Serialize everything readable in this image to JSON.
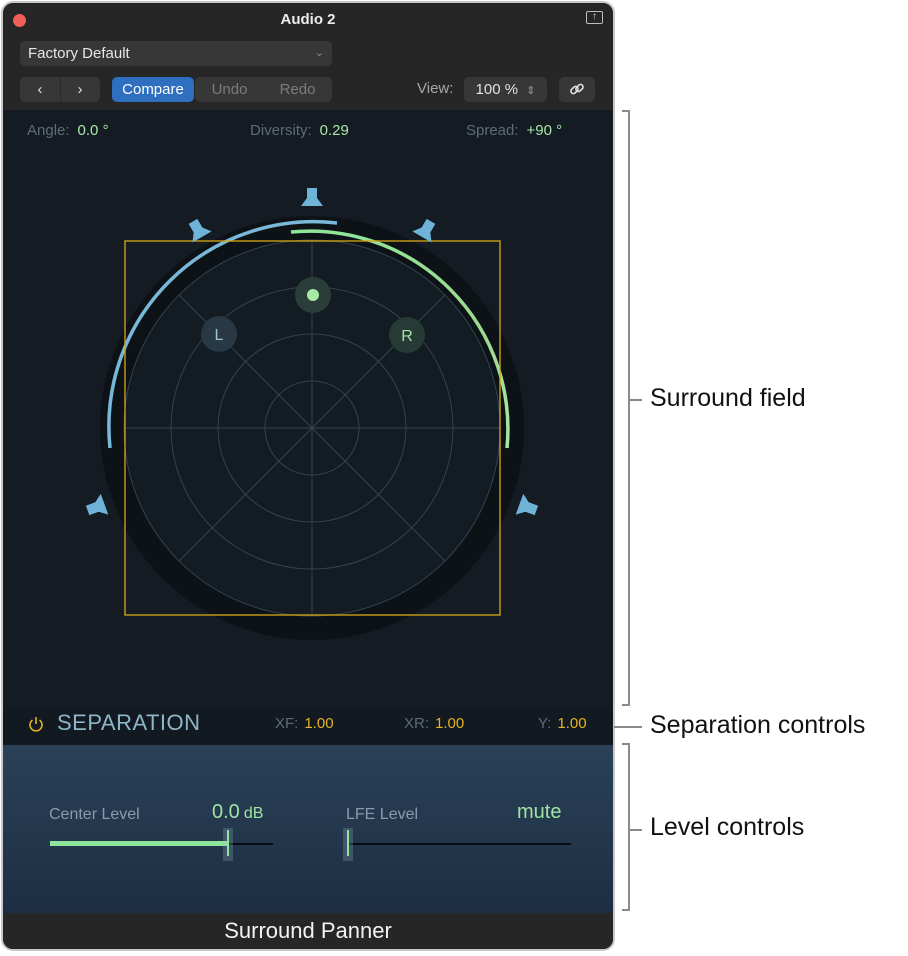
{
  "window": {
    "title": "Audio 2",
    "preset": "Factory Default",
    "footer_title": "Surround Panner"
  },
  "toolbar": {
    "prev_icon": "chevron-left-icon",
    "next_icon": "chevron-right-icon",
    "prev_label": "‹",
    "next_label": "›",
    "compare_label": "Compare",
    "undo_label": "Undo",
    "redo_label": "Redo",
    "view_label": "View:",
    "view_value": "100 %",
    "link_icon": "link-icon",
    "detach_icon": "detach-icon"
  },
  "readouts": {
    "angle_label": "Angle:",
    "angle_value": "0.0 °",
    "diversity_label": "Diversity:",
    "diversity_value": "0.29",
    "spread_label": "Spread:",
    "spread_value": "+90 °"
  },
  "surround_field": {
    "channels": [
      {
        "label": "L"
      },
      {
        "label": "R"
      }
    ],
    "speakers": [
      "center",
      "left",
      "right",
      "left-surround",
      "right-surround"
    ]
  },
  "separation": {
    "title": "SEPARATION",
    "xf_label": "XF:",
    "xf_value": "1.00",
    "xr_label": "XR:",
    "xr_value": "1.00",
    "y_label": "Y:",
    "y_value": "1.00"
  },
  "levels": {
    "center_label": "Center Level",
    "center_value": "0.0",
    "center_unit": "dB",
    "center_fraction": 0.8,
    "lfe_label": "LFE Level",
    "lfe_value": "mute",
    "lfe_fraction": 0.0
  },
  "callouts": {
    "surround_field": "Surround field",
    "separation_controls": "Separation controls",
    "level_controls": "Level controls"
  },
  "colors": {
    "accent_green": "#a6e9a5",
    "accent_blue": "#7ab8d9",
    "accent_yellow": "#e6b420",
    "compare_blue": "#2f6fc0"
  }
}
